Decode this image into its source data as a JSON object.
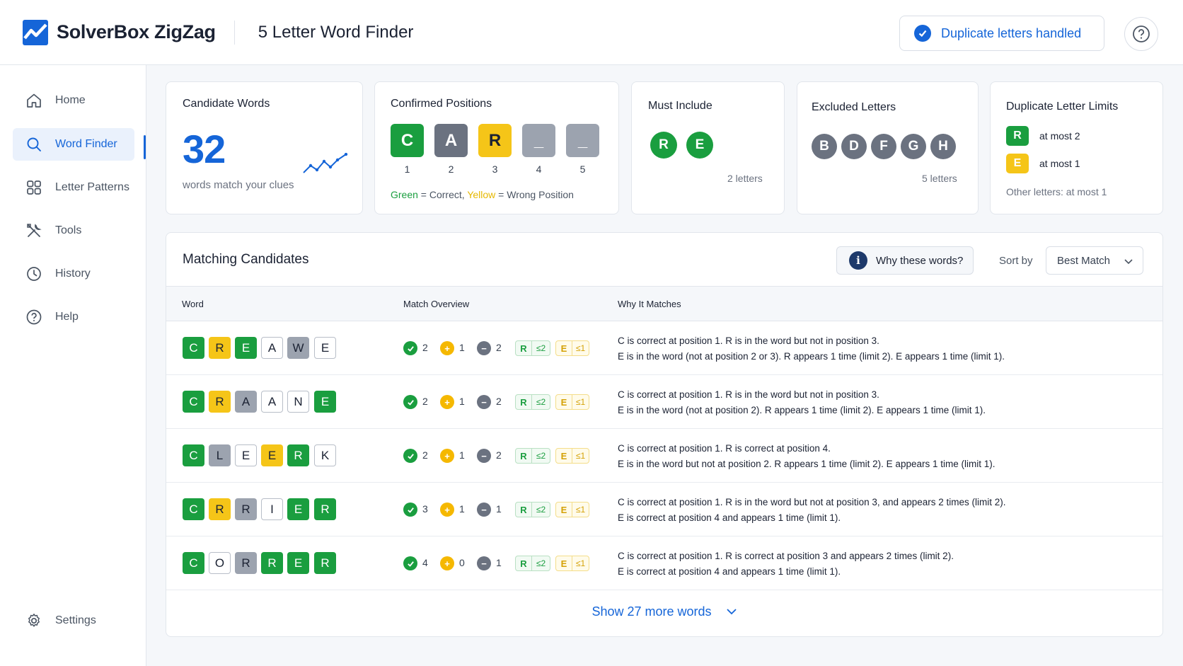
{
  "app": {
    "brand": "SolverBox ZigZag",
    "page_title": "5 Letter Word Finder",
    "duplicate_badge": "Duplicate letters handled"
  },
  "sidebar": {
    "items": [
      {
        "label": "Home",
        "icon": "home-icon"
      },
      {
        "label": "Word Finder",
        "icon": "search-icon"
      },
      {
        "label": "Letter Patterns",
        "icon": "grid-icon"
      },
      {
        "label": "Tools",
        "icon": "tools-icon"
      },
      {
        "label": "History",
        "icon": "clock-icon"
      },
      {
        "label": "Help",
        "icon": "help-icon"
      }
    ],
    "settings": "Settings"
  },
  "cards": {
    "candidates": {
      "title": "Candidate Words",
      "count": "32",
      "caption": "words match your clues"
    },
    "confirmed": {
      "title": "Confirmed Positions",
      "tiles": [
        {
          "letter": "C",
          "num": "1",
          "state": "green"
        },
        {
          "letter": "A",
          "num": "2",
          "state": "gray"
        },
        {
          "letter": "R",
          "num": "3",
          "state": "yellow"
        },
        {
          "letter": "_",
          "num": "4",
          "state": "gray"
        },
        {
          "letter": "_",
          "num": "5",
          "state": "gray"
        }
      ],
      "legend_green": "Green",
      "legend_mid": " = Correct, ",
      "legend_yellow": "Yellow",
      "legend_end": " = Wrong Position"
    },
    "must_include": {
      "title": "Must Include",
      "letters": [
        "R",
        "E"
      ],
      "count": "2 letters"
    },
    "excluded": {
      "title": "Excluded Letters",
      "letters": [
        "B",
        "D",
        "F",
        "G",
        "H"
      ],
      "count": "5 letters"
    },
    "limits": {
      "title": "Duplicate Letter Limits",
      "items": [
        {
          "letter": "R",
          "text": "at most 2"
        },
        {
          "letter": "E",
          "text": "at most 1"
        }
      ],
      "other": "Other letters: at most 1"
    }
  },
  "table": {
    "title": "Matching Candidates",
    "why_button": "Why these words?",
    "sort_label": "Sort by",
    "sort_value": "Best Match",
    "headers": {
      "word": "Word",
      "overview": "Match Overview",
      "why": "Why It Matches"
    },
    "chips": {
      "r_letter": "R",
      "r_limit": "≤2",
      "e_letter": "E",
      "e_limit": "≤1"
    },
    "rows": [
      {
        "tiles": [
          [
            "C",
            "g"
          ],
          [
            "R",
            "y"
          ],
          [
            "E",
            "g"
          ],
          [
            "A",
            "w"
          ],
          [
            "W",
            "gr"
          ],
          [
            "E",
            "w"
          ]
        ],
        "correct": "2",
        "present": "1",
        "absent": "2",
        "why1": "C is correct at position 1. R is in the word but not in position 3.",
        "why2": "E is in the word (not at position 2 or 3).  R appears 1 time (limit 2).  E appears 1 time (limit 1)."
      },
      {
        "tiles": [
          [
            "C",
            "g"
          ],
          [
            "R",
            "y"
          ],
          [
            "A",
            "gr"
          ],
          [
            "A",
            "w"
          ],
          [
            "N",
            "w"
          ],
          [
            "E",
            "g"
          ]
        ],
        "correct": "2",
        "present": "1",
        "absent": "2",
        "why1": "C is correct at position 1. R is in the word but not in position 3.",
        "why2": "E is in the word (not at position 2).  R appears 1 time (limit 2).  E appears 1 time (limit 1)."
      },
      {
        "tiles": [
          [
            "C",
            "g"
          ],
          [
            "L",
            "gr"
          ],
          [
            "E",
            "w"
          ],
          [
            "E",
            "y"
          ],
          [
            "R",
            "g"
          ],
          [
            "K",
            "w"
          ]
        ],
        "correct": "2",
        "present": "1",
        "absent": "2",
        "why1": "C is correct at position 1. R is correct at position 4.",
        "why2": "E is in the word but not at position 2.  R appears 1 time (limit 2).  E appears 1 time (limit 1)."
      },
      {
        "tiles": [
          [
            "C",
            "g"
          ],
          [
            "R",
            "y"
          ],
          [
            "R",
            "gr"
          ],
          [
            "I",
            "w"
          ],
          [
            "E",
            "g"
          ],
          [
            "R",
            "g"
          ]
        ],
        "correct": "3",
        "present": "1",
        "absent": "1",
        "why1": "C is correct at position 1. R is in the word but not at position 3, and appears 2 times (limit 2).",
        "why2": "E is correct at position 4 and appears 1 time (limit 1)."
      },
      {
        "tiles": [
          [
            "C",
            "g"
          ],
          [
            "O",
            "w"
          ],
          [
            "R",
            "gr"
          ],
          [
            "R",
            "g"
          ],
          [
            "E",
            "g"
          ],
          [
            "R",
            "g"
          ]
        ],
        "correct": "4",
        "present": "0",
        "absent": "1",
        "why1": "C is correct at position 1. R is correct at position 3 and appears 2 times (limit 2).",
        "why2": "E is correct at position 4 and appears 1 time (limit 1)."
      }
    ],
    "show_more": "Show 27 more words"
  },
  "colors": {
    "accent": "#1565d8",
    "green": "#1a9e3f",
    "yellow": "#f5c518",
    "gray": "#9ca3af",
    "excluded": "#6b7280"
  }
}
